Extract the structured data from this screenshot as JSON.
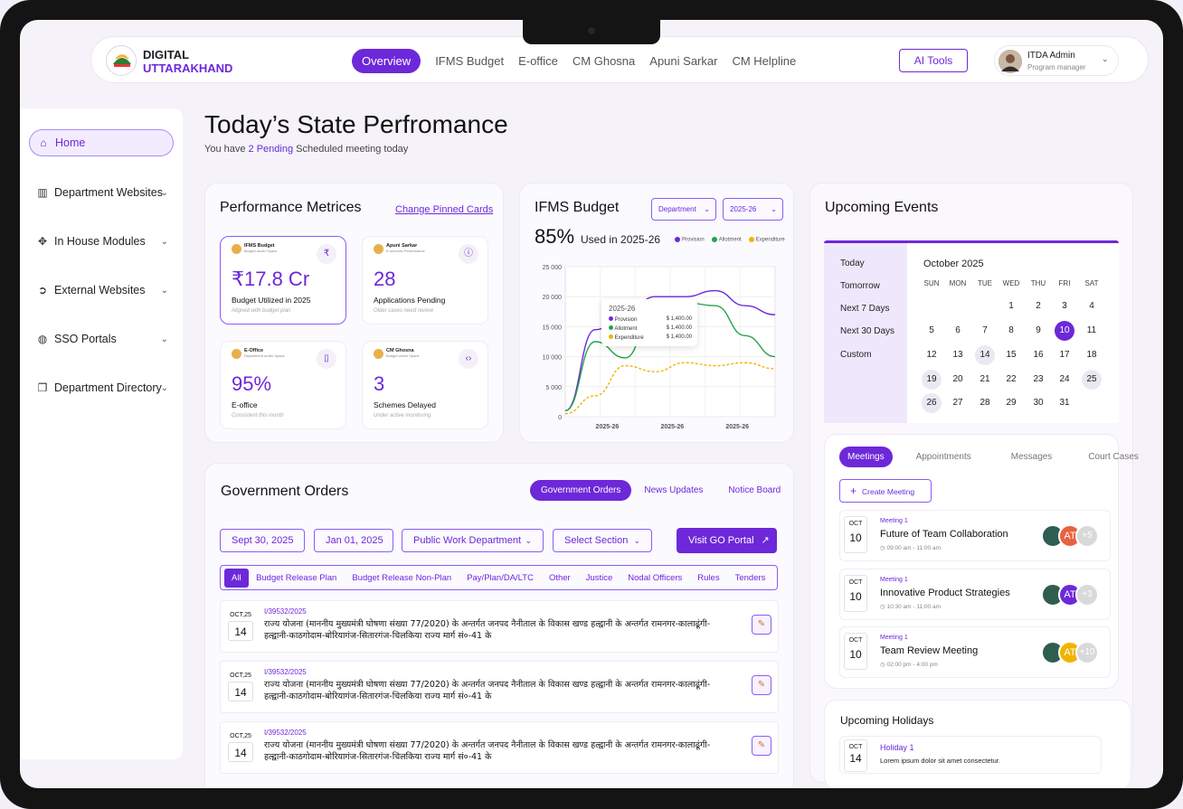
{
  "brand": {
    "line1": "DIGITAL",
    "line2": "UTTARAKHAND"
  },
  "nav": [
    "Overview",
    "IFMS Budget",
    "E-office",
    "CM Ghosna",
    "Apuni Sarkar",
    "CM Helpline"
  ],
  "ai_tools": "AI Tools",
  "user": {
    "name": "ITDA Admin",
    "role": "Program manager"
  },
  "sidebar": [
    {
      "label": "Home",
      "icon": "home-icon"
    },
    {
      "label": "Department Websites",
      "icon": "building-icon"
    },
    {
      "label": "In House Modules",
      "icon": "modules-icon"
    },
    {
      "label": "External Websites",
      "icon": "arrow-circle-icon"
    },
    {
      "label": "SSO Portals",
      "icon": "globe-icon"
    },
    {
      "label": "Department Directory",
      "icon": "directory-icon"
    }
  ],
  "page": {
    "title": "Today’s State Perfromance",
    "sub_pre": "You have",
    "sub_hl": "2 Pending",
    "sub_post": "Scheduled meeting today"
  },
  "metrics": {
    "title": "Performance Metrices",
    "link": "Change Pinned Cards",
    "cards": [
      {
        "label": "IFMS Budget",
        "sub": "Budget under Space",
        "value": "₹17.8 Cr",
        "name": "Budget Utilized in 2025",
        "note": "Aligned with budget plan",
        "icon": "rupee-icon"
      },
      {
        "label": "Apuni Sarkar",
        "sub": "E-services Performance",
        "value": "28",
        "name": "Applications Pending",
        "note": "Older cases need review",
        "icon": "info-icon"
      },
      {
        "label": "E-Office",
        "sub": "Department under Space",
        "value": "95%",
        "name": "E-office",
        "note": "Consistent this month",
        "icon": "document-icon"
      },
      {
        "label": "CM Ghosna",
        "sub": "Budget under Space",
        "value": "3",
        "name": "Schemes Delayed",
        "note": "Under active monitoring",
        "icon": "code-icon"
      }
    ]
  },
  "ifms": {
    "title": "IFMS Budget",
    "dept_select": "Department",
    "year_select": "2025-26",
    "percent": "85%",
    "used": "Used in 2025-26",
    "tooltip": {
      "title": "2025-26",
      "rows": [
        [
          "Provision",
          "$ 1,400.00"
        ],
        [
          "Allotment",
          "$ 1,400.00"
        ],
        [
          "Expenditure",
          "$ 1,400.00"
        ]
      ]
    }
  },
  "chart_data": {
    "type": "line",
    "x": [
      "2025-26",
      "2025-26",
      "2025-26"
    ],
    "ylim": [
      0,
      25000
    ],
    "yticks": [
      "25 000",
      "20 000",
      "15 000",
      "10 000",
      "5 000",
      "0"
    ],
    "colors": {
      "Provision": "#6d28d9",
      "Allotment": "#22a447",
      "Expenditure": "#f0b400"
    },
    "series": [
      {
        "name": "Provision",
        "values": [
          1000,
          14500,
          17000,
          20000,
          20000,
          21000,
          18500,
          17000
        ]
      },
      {
        "name": "Allotment",
        "values": [
          1000,
          12500,
          9800,
          18500,
          19000,
          18500,
          13500,
          10000
        ]
      },
      {
        "name": "Expenditure",
        "values": [
          500,
          3500,
          8500,
          7500,
          9000,
          8500,
          9000,
          8000
        ]
      }
    ]
  },
  "events": {
    "title": "Upcoming Events",
    "ranges": [
      "Today",
      "Tomorrow",
      "Next 7 Days",
      "Next 30 Days",
      "Custom"
    ],
    "month": "October 2025",
    "dow": [
      "SUN",
      "MON",
      "TUE",
      "WED",
      "THU",
      "FRI",
      "SAT"
    ],
    "days": [
      1,
      2,
      3,
      4,
      5,
      6,
      7,
      8,
      9,
      10,
      11,
      12,
      13,
      14,
      15,
      16,
      17,
      18,
      19,
      20,
      21,
      22,
      23,
      24,
      25,
      26,
      27,
      28,
      29,
      30,
      31
    ],
    "today": 10,
    "marked": [
      14,
      19,
      25,
      26
    ],
    "tabs": [
      "Meetings",
      "Appointments",
      "Messages",
      "Court Cases"
    ],
    "create": "Create Meeting",
    "meetings": [
      {
        "month": "OCT",
        "day": "10",
        "tag": "Meeting 1",
        "title": "Future of Team Collaboration",
        "time": "09:00 am - 11:00 am",
        "more": "+5"
      },
      {
        "month": "OCT",
        "day": "10",
        "tag": "Meeting 1",
        "title": "Innovative Product Strategies",
        "time": "10:30 am - 11:00 am",
        "more": "+3"
      },
      {
        "month": "OCT",
        "day": "10",
        "tag": "Meeting 1",
        "title": "Team Review Meeting",
        "time": "02:00 pm - 4:00 pm",
        "more": "+10"
      }
    ],
    "avatar_initials": "AT"
  },
  "holidays": {
    "title": "Upcoming Holidays",
    "items": [
      {
        "month": "OCT",
        "day": "14",
        "name": "Holiday 1",
        "desc": "Lorem ipsum dolor sit amet consectetur."
      }
    ]
  },
  "orders": {
    "title": "Government Orders",
    "tabs": [
      "Government Orders",
      "News Updates",
      "Notice Board"
    ],
    "filters": {
      "from": "Sept 30, 2025",
      "to": "Jan 01, 2025",
      "dept": "Public Work Department",
      "section": "Select Section",
      "portal": "Visit GO Portal"
    },
    "categories": [
      "All",
      "Budget Release Plan",
      "Budget Release Non-Plan",
      "Pay/Plan/DA/LTC",
      "Other",
      "Justice",
      "Nodal Officers",
      "Rules",
      "Tenders"
    ],
    "rows": [
      {
        "month": "OCT,25",
        "day": "14",
        "no": "I/39532/2025",
        "text": "राज्य योजना (माननीय मुख्यमंत्री घोषणा संख्या 77/2020) के अन्तर्गत जनपद नैनीताल के विकास खण्ड हल्द्वानी के अन्तर्गत रामनगर-कालाढूंगी-हल्द्वानी-काठगोदाम-बोरियागंज-सितारगंज-चिलकिया राज्य मार्ग सं०-41 के"
      },
      {
        "month": "OCT,25",
        "day": "14",
        "no": "I/39532/2025",
        "text": "राज्य योजना (माननीय मुख्यमंत्री घोषणा संख्या 77/2020) के अन्तर्गत जनपद नैनीताल के विकास खण्ड हल्द्वानी के अन्तर्गत रामनगर-कालाढूंगी-हल्द्वानी-काठगोदाम-बोरियागंज-सितारगंज-चिलकिया राज्य मार्ग सं०-41 के"
      },
      {
        "month": "OCT,25",
        "day": "14",
        "no": "I/39532/2025",
        "text": "राज्य योजना (माननीय मुख्यमंत्री घोषणा संख्या 77/2020) के अन्तर्गत जनपद नैनीताल के विकास खण्ड हल्द्वानी के अन्तर्गत रामनगर-कालाढूंगी-हल्द्वानी-काठगोदाम-बोरियागंज-सितारगंज-चिलकिया राज्य मार्ग सं०-41 के"
      }
    ]
  }
}
